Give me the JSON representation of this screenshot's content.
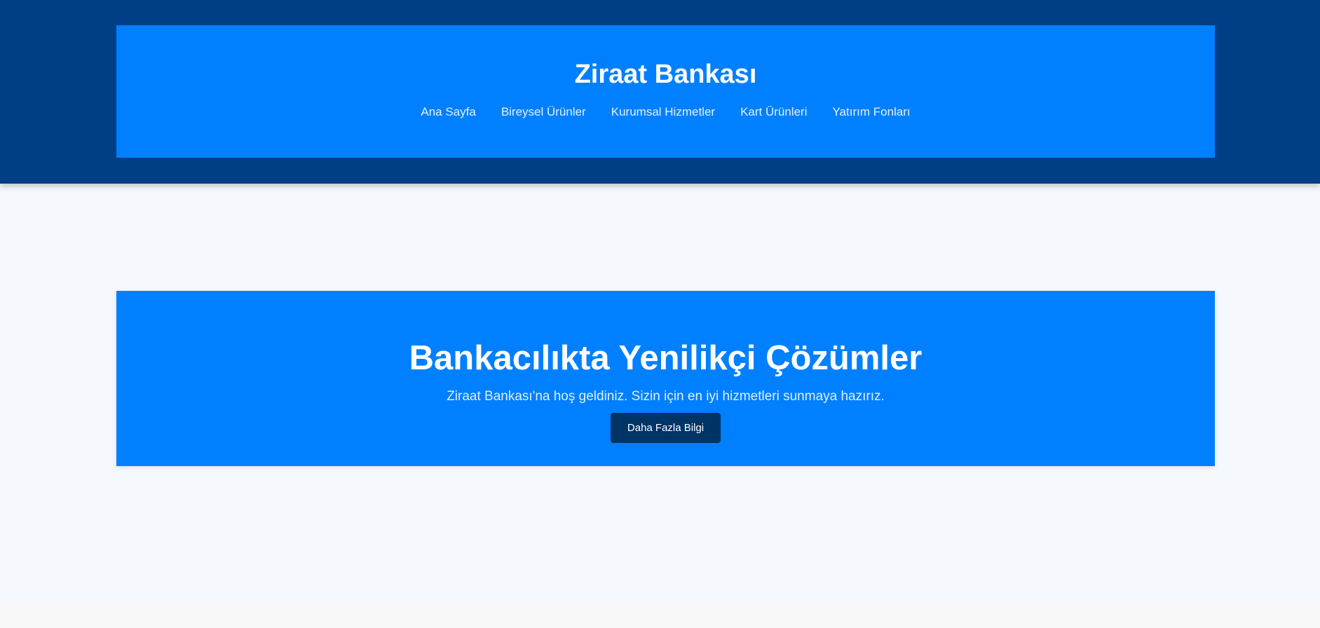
{
  "header": {
    "title": "Ziraat Bankası",
    "nav": [
      "Ana Sayfa",
      "Bireysel Ürünler",
      "Kurumsal Hizmetler",
      "Kart Ürünleri",
      "Yatırım Fonları"
    ]
  },
  "hero": {
    "title": "Bankacılıkta Yenilikçi Çözümler",
    "subtitle": "Ziraat Bankası'na hoş geldiniz. Sizin için en iyi hizmetleri sunmaya hazırız.",
    "button": "Daha Fazla Bilgi"
  },
  "colors": {
    "header_bg": "#003f85",
    "accent": "#0080ff",
    "button": "#003366",
    "page_bg": "#f5f8fc"
  }
}
